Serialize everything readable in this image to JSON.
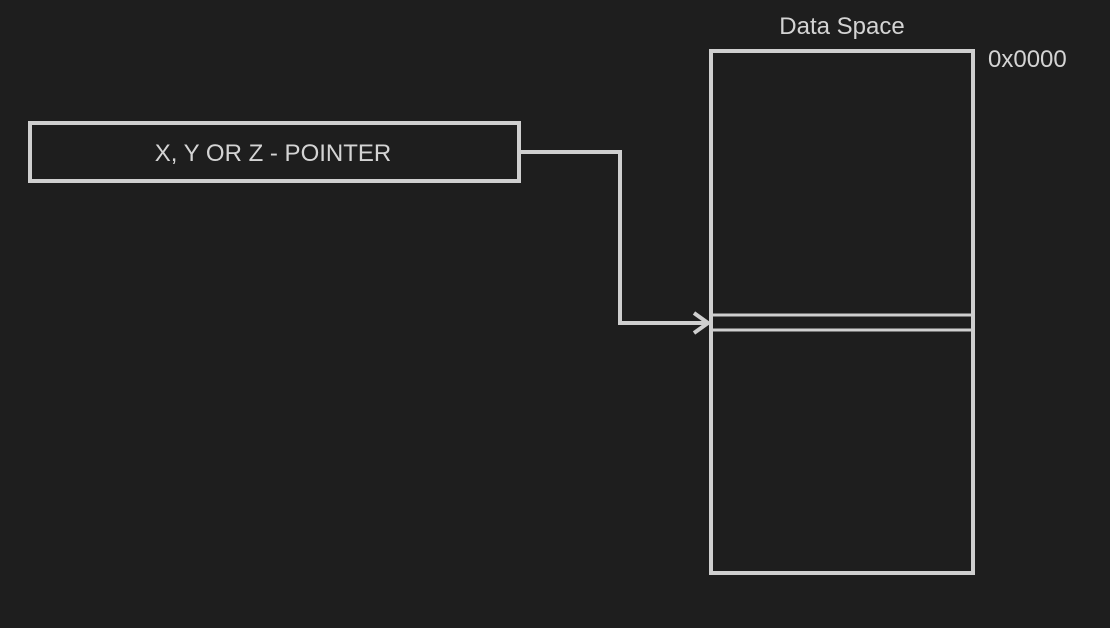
{
  "diagram": {
    "pointer_label": "X, Y OR Z - POINTER",
    "memory_title": "Data Space",
    "start_address": "0x0000"
  },
  "colors": {
    "background": "#1e1e1e",
    "stroke": "#cfcfcf",
    "text": "#d4d4d4"
  }
}
